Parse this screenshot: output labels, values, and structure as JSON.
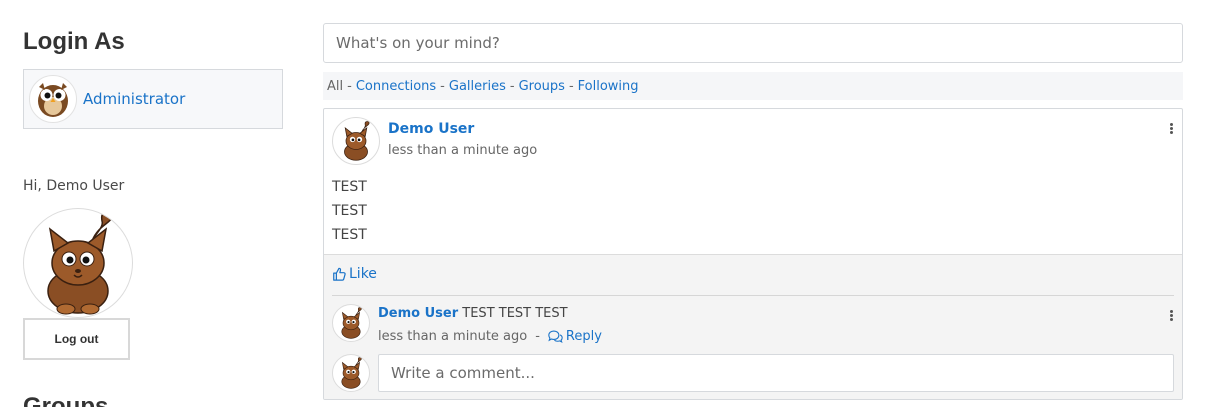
{
  "left": {
    "login_heading": "Login As",
    "login_user": "Administrator",
    "greeting": "Hi, Demo User",
    "logout_label": "Log out",
    "groups_heading": "Groups"
  },
  "status": {
    "placeholder": "What's on your mind?"
  },
  "filters": {
    "all": "All",
    "separator": "-",
    "items": [
      "Connections",
      "Galleries",
      "Groups",
      "Following"
    ]
  },
  "post": {
    "author": "Demo User",
    "time": "less than a minute ago",
    "lines": [
      "TEST",
      "TEST",
      "TEST"
    ],
    "like_label": "Like",
    "comment": {
      "author": "Demo User",
      "text": "TEST TEST TEST",
      "time": "less than a minute ago",
      "separator": "-",
      "reply_label": "Reply"
    },
    "comment_placeholder": "Write a comment..."
  },
  "colors": {
    "link": "#1a73c8",
    "panel_bg": "#f7f8fa",
    "footer_bg": "#f4f4f4"
  },
  "icons": [
    "owl-avatar-icon",
    "cat-avatar-icon",
    "thumbs-up-icon",
    "comments-icon",
    "kebab-menu-icon"
  ]
}
